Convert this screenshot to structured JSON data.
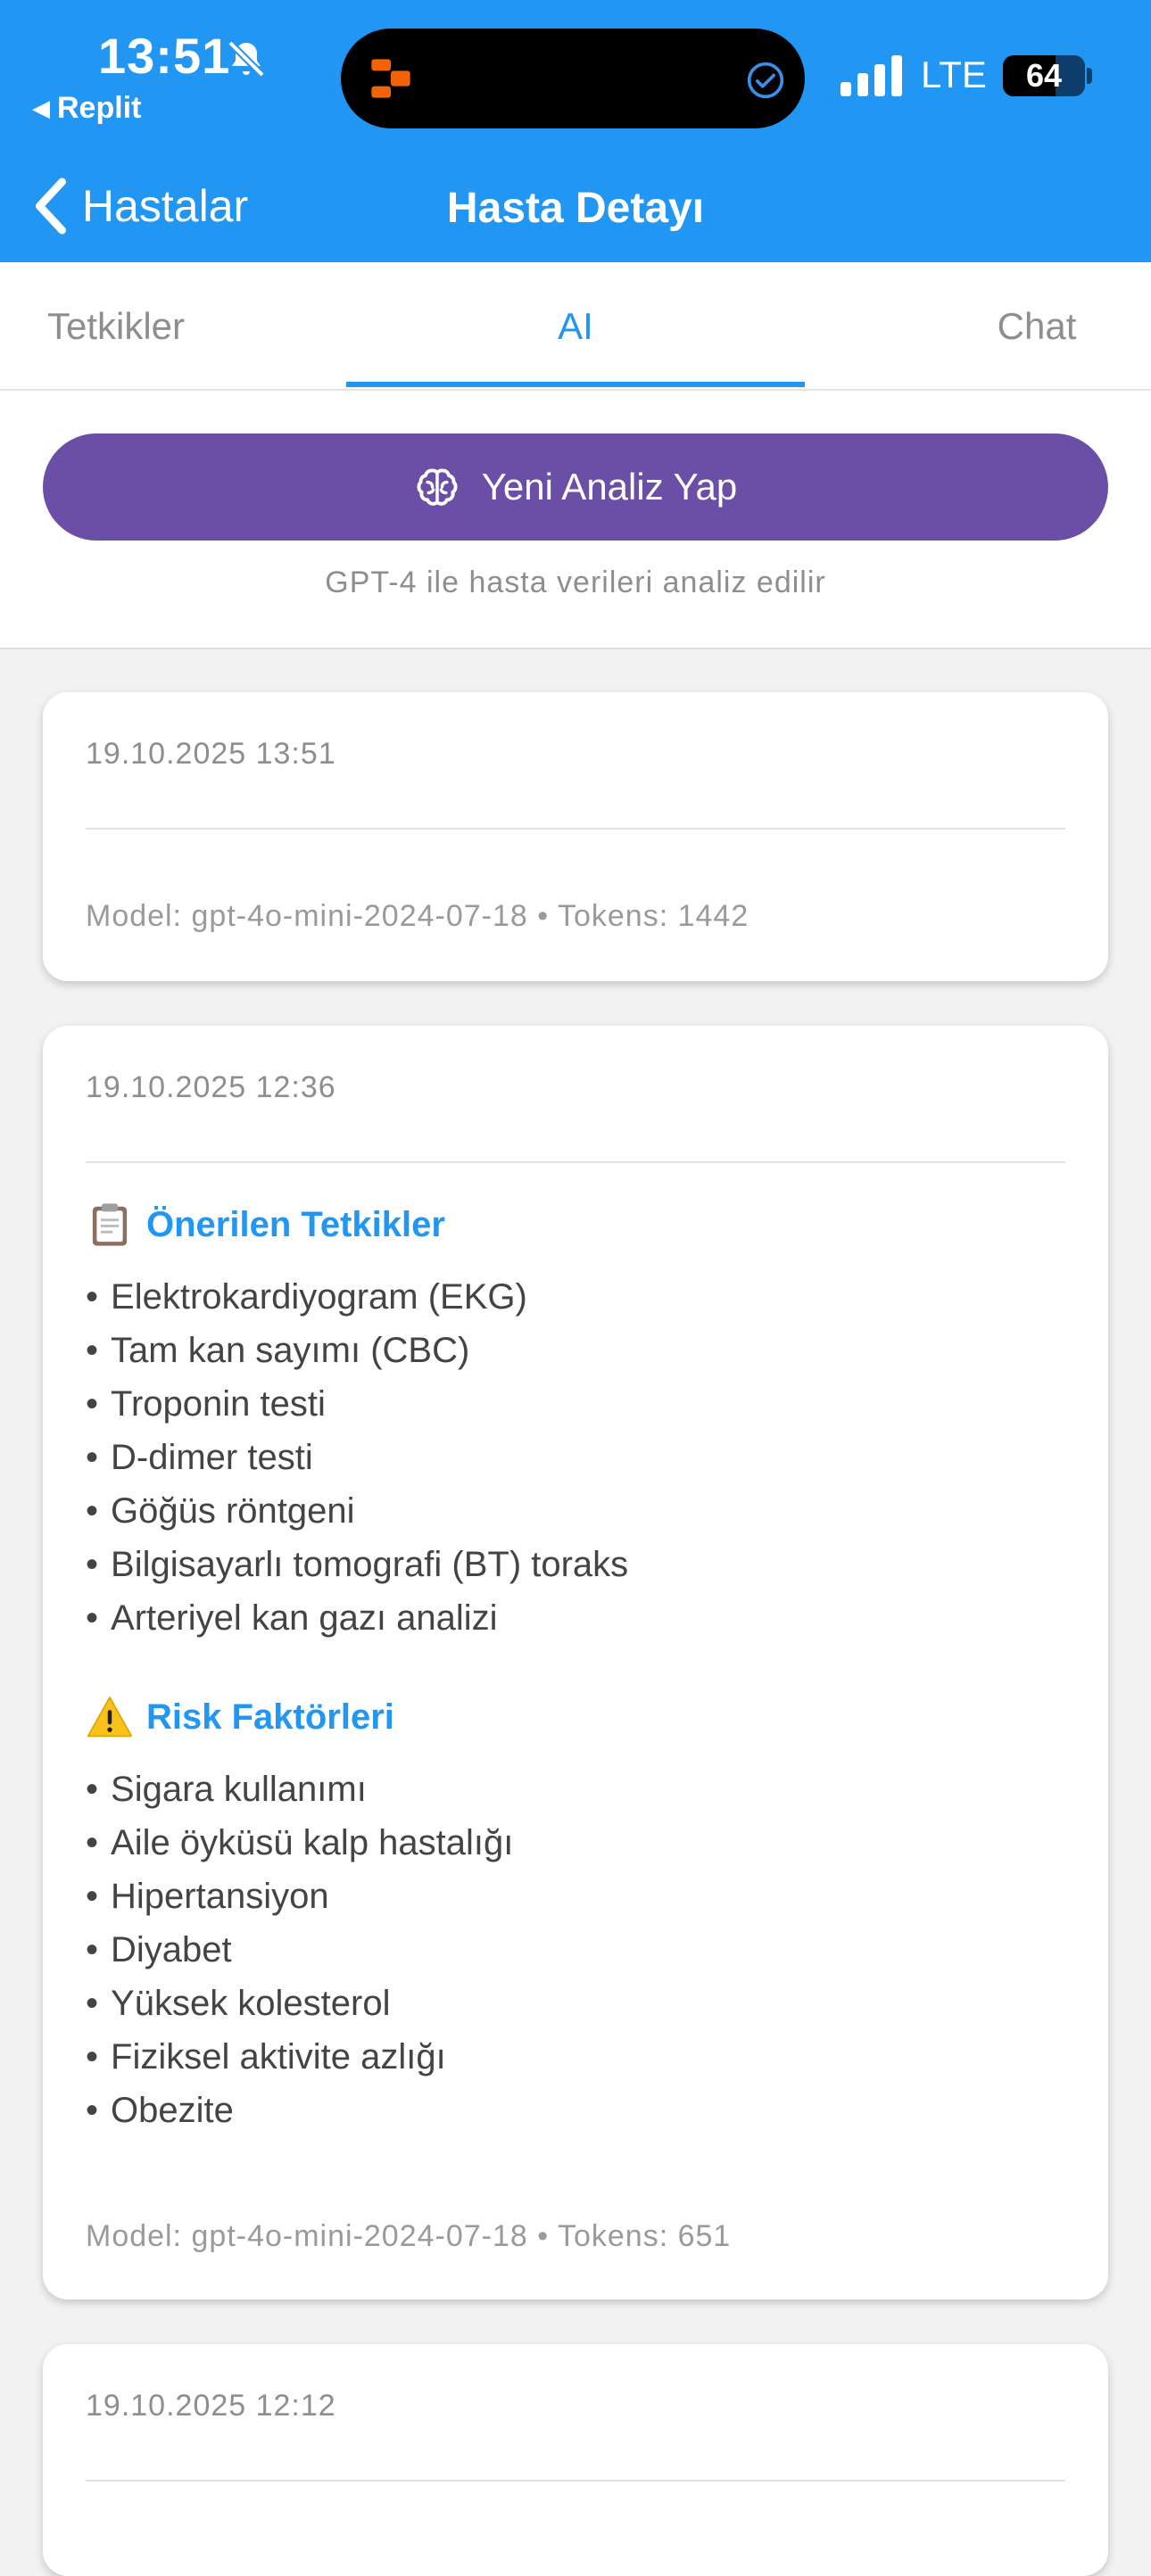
{
  "status_bar": {
    "time": "13:51",
    "back_app": "Replit",
    "network": "LTE",
    "battery": "64",
    "battery_level": 0.64
  },
  "nav": {
    "back_label": "Hastalar",
    "title": "Hasta Detayı"
  },
  "tabs": [
    {
      "label": "Tetkikler",
      "active": false
    },
    {
      "label": "AI",
      "active": true
    },
    {
      "label": "Chat",
      "active": false
    }
  ],
  "analyze": {
    "button_label": "Yeni Analiz Yap",
    "note": "GPT-4 ile hasta verileri analiz edilir"
  },
  "analyses": [
    {
      "date": "19.10.2025 13:51",
      "meta": "Model: gpt-4o-mini-2024-07-18 • Tokens: 1442"
    },
    {
      "date": "19.10.2025 12:36",
      "sections": [
        {
          "icon": "clipboard-icon",
          "title": "Önerilen Tetkikler",
          "items": [
            "Elektrokardiyogram (EKG)",
            "Tam kan sayımı (CBC)",
            "Troponin testi",
            "D-dimer testi",
            "Göğüs röntgeni",
            "Bilgisayarlı tomografi (BT) toraks",
            "Arteriyel kan gazı analizi"
          ]
        },
        {
          "icon": "warning-icon",
          "title": "Risk Faktörleri",
          "items": [
            "Sigara kullanımı",
            "Aile öyküsü kalp hastalığı",
            "Hipertansiyon",
            "Diyabet",
            "Yüksek kolesterol",
            "Fiziksel aktivite azlığı",
            "Obezite"
          ]
        }
      ],
      "meta": "Model: gpt-4o-mini-2024-07-18 • Tokens: 651"
    },
    {
      "date": "19.10.2025 12:12"
    }
  ],
  "colors": {
    "header": "#2196f3",
    "accent": "#2196f3",
    "analyze_button": "#6b4fa6",
    "background": "#f2f2f2"
  }
}
